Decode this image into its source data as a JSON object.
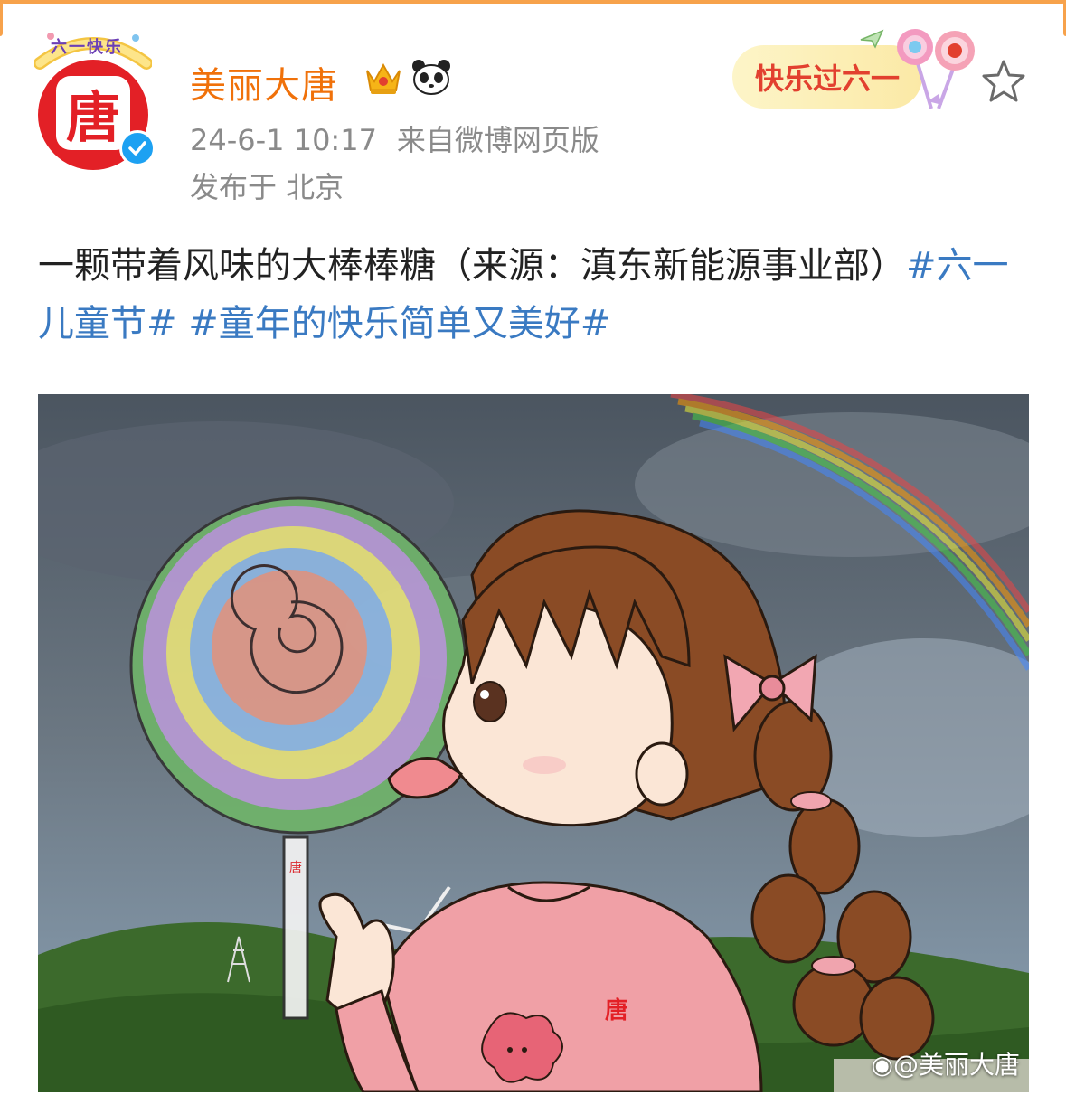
{
  "header": {
    "username": "美丽大唐",
    "avatar_frame_text": "六一快乐",
    "avatar_logo": "唐",
    "timestamp": "24-6-1 10:17",
    "source": "来自微博网页版",
    "location": "发布于 北京",
    "sticker_text": "快乐过六一",
    "icons": [
      "crown-badge-icon",
      "panda-badge-icon",
      "verified-icon",
      "star-icon"
    ]
  },
  "post": {
    "text": "一颗带着风味的大棒棒糖（来源：滇东新能源事业部）",
    "topics": [
      "#六一儿童节#",
      "#童年的快乐简单又美好#"
    ]
  },
  "image": {
    "watermark": "@美丽大唐",
    "shirt_logo": "唐",
    "stick_logo": "唐"
  },
  "colors": {
    "username": "#f0710a",
    "topic": "#3a7ac2",
    "avatar_bg": "#e32026",
    "verified": "#1da1f2"
  }
}
